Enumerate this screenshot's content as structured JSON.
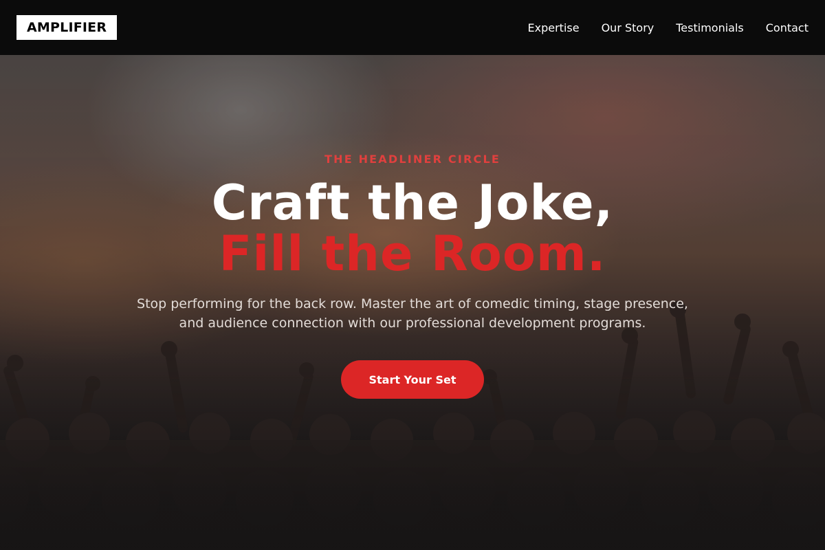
{
  "brand": {
    "logo_text": "AMPLIFIER"
  },
  "nav": {
    "items": [
      {
        "label": "Expertise"
      },
      {
        "label": "Our Story"
      },
      {
        "label": "Testimonials"
      },
      {
        "label": "Contact"
      }
    ]
  },
  "hero": {
    "eyebrow": "THE HEADLINER CIRCLE",
    "headline_line1": "Craft the Joke,",
    "headline_line2": "Fill the Room.",
    "subtitle_line1": "Stop performing for the back row. Master the art of comedic timing, stage presence,",
    "subtitle_line2": "and audience connection with our professional development programs.",
    "cta_label": "Start Your Set"
  },
  "colors": {
    "accent": "#dc2626",
    "nav_background": "#0b0b0b",
    "logo_background": "#ffffff"
  }
}
